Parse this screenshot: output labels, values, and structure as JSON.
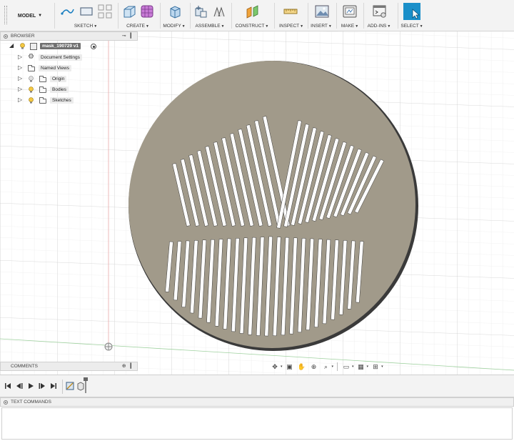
{
  "toolbar": {
    "model_label": "MODEL",
    "groups": [
      {
        "label": "SKETCH"
      },
      {
        "label": "CREATE"
      },
      {
        "label": "MODIFY"
      },
      {
        "label": "ASSEMBLE"
      },
      {
        "label": "CONSTRUCT"
      },
      {
        "label": "INSPECT"
      },
      {
        "label": "INSERT"
      },
      {
        "label": "MAKE"
      },
      {
        "label": "ADD-INS"
      },
      {
        "label": "SELECT"
      }
    ],
    "accent_color": "#1a8fc9"
  },
  "browser": {
    "title": "BROWSER",
    "root": "mask_190729 v1",
    "items": [
      {
        "label": "Document Settings",
        "icon": "gear-icon"
      },
      {
        "label": "Named Views",
        "icon": "folder-icon"
      },
      {
        "label": "Origin",
        "icon": "folder-icon"
      },
      {
        "label": "Bodies",
        "icon": "folder-icon"
      },
      {
        "label": "Sketches",
        "icon": "folder-icon"
      }
    ]
  },
  "comments": {
    "title": "COMMENTS"
  },
  "text_commands": {
    "title": "TEXT COMMANDS"
  },
  "model": {
    "body_color": "#a19a8a",
    "edge_color": "#3a3a3a",
    "slot_color": "#ffffff"
  },
  "viewport": {
    "grid_color": "#dcdcdc",
    "x_axis_color": "#8fc98f",
    "y_axis_color": "#e29a9a"
  }
}
